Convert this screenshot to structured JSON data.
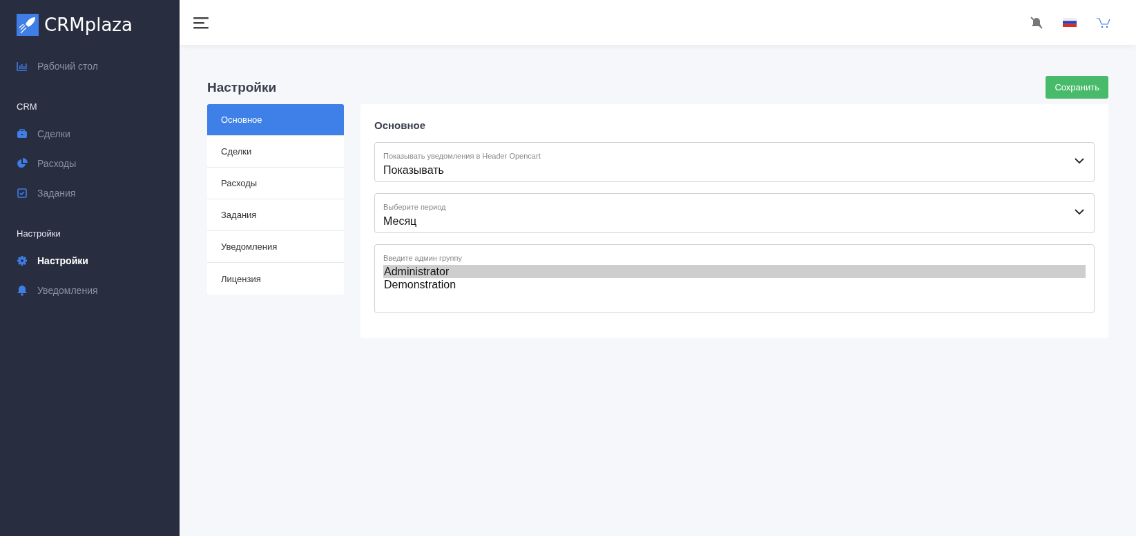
{
  "brand": {
    "name": "CRMplaza"
  },
  "sidebar": {
    "groups": [
      {
        "items": [
          {
            "label": "Рабочий стол",
            "selected": false
          }
        ]
      },
      {
        "title": "CRM",
        "items": [
          {
            "label": "Сделки",
            "selected": false
          },
          {
            "label": "Расходы",
            "selected": false
          },
          {
            "label": "Задания",
            "selected": false
          }
        ]
      },
      {
        "title": "Настройки",
        "items": [
          {
            "label": "Настройки",
            "selected": true
          },
          {
            "label": "Уведомления",
            "selected": false
          }
        ]
      }
    ]
  },
  "page": {
    "title": "Настройки",
    "save_button": "Сохранить"
  },
  "tabs": [
    {
      "label": "Основное",
      "selected": true
    },
    {
      "label": "Сделки",
      "selected": false
    },
    {
      "label": "Расходы",
      "selected": false
    },
    {
      "label": "Задания",
      "selected": false
    },
    {
      "label": "Уведомления",
      "selected": false
    },
    {
      "label": "Лицензия",
      "selected": false
    }
  ],
  "panel": {
    "title": "Основное",
    "fields": [
      {
        "kind": "select",
        "label": "Показывать уведомления в Header Opencart",
        "value": "Показывать"
      },
      {
        "kind": "select",
        "label": "Выберите период",
        "value": "Месяц"
      },
      {
        "kind": "listbox",
        "label": "Введите админ группу",
        "options": [
          {
            "label": "Administrator",
            "selected": true
          },
          {
            "label": "Demonstration",
            "selected": false
          }
        ]
      }
    ]
  }
}
